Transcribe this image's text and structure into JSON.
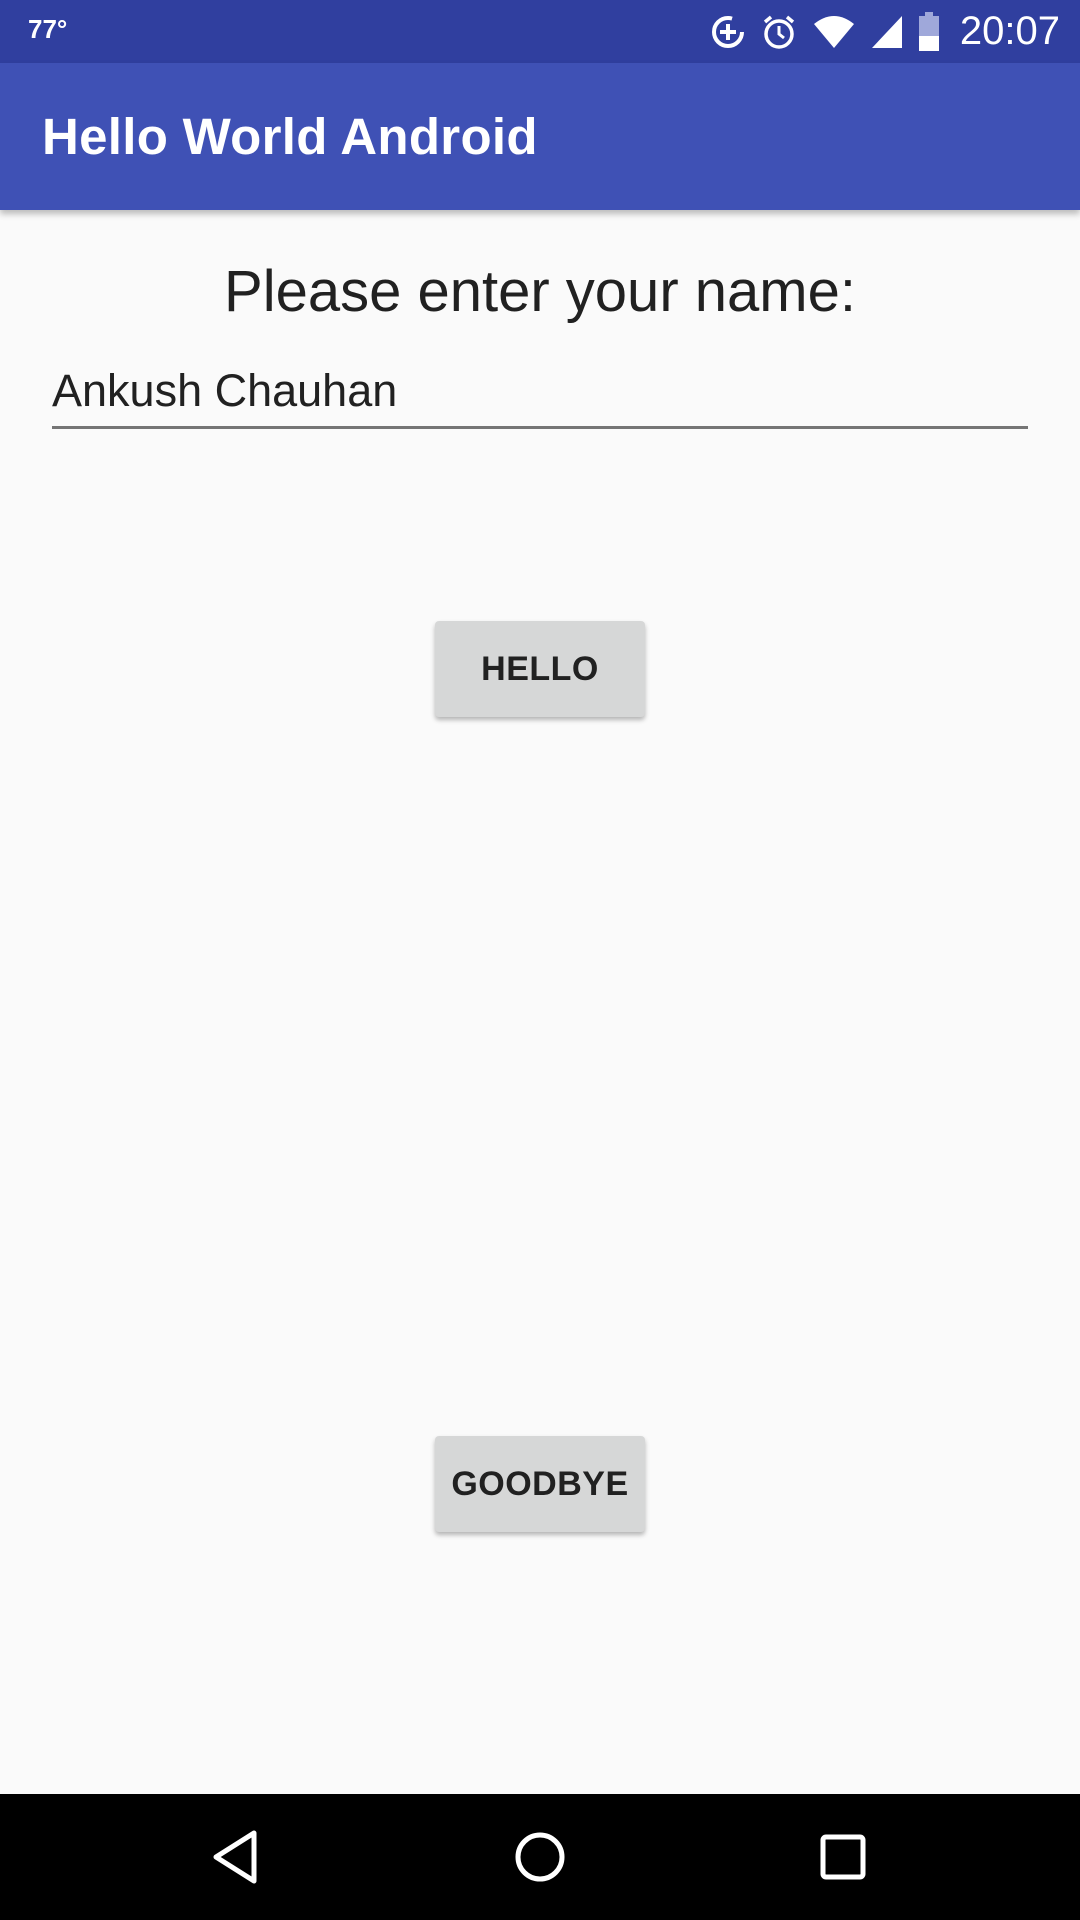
{
  "status_bar": {
    "temperature": "77°",
    "time": "20:07",
    "icons": [
      "data-saver-icon",
      "alarm-icon",
      "wifi-icon",
      "signal-icon",
      "battery-icon"
    ]
  },
  "app_bar": {
    "title": "Hello World Android",
    "color": "#3f51b5"
  },
  "content": {
    "prompt": "Please enter your name:",
    "name_input_value": "Ankush Chauhan",
    "hello_button": "HELLO",
    "goodbye_button": "GOODBYE"
  },
  "nav_bar": {
    "icons": [
      "back-icon",
      "home-icon",
      "recents-icon"
    ]
  },
  "colors": {
    "status_bar": "#303f9f",
    "app_bar": "#3f51b5",
    "background": "#fafafa",
    "button": "#d6d7d7"
  }
}
